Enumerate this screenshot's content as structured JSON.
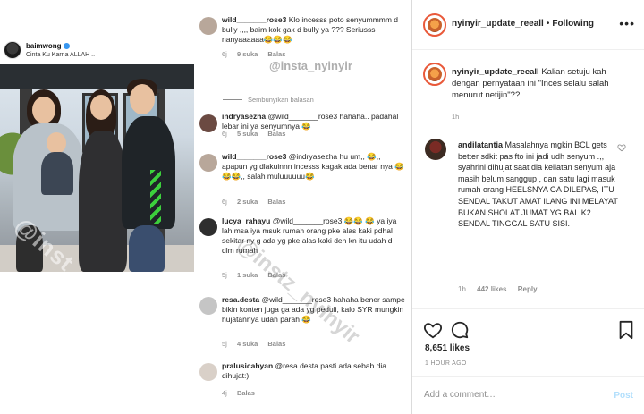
{
  "story": {
    "username": "baimwong",
    "caption": "Cinta Ku Karna ALLAH ..",
    "watermark": "@inst_nyinyir"
  },
  "comments": [
    {
      "username": "wild_______rose3",
      "text": "Klo incesss poto senyummmm d bully ,,,, baim kok gak d bully ya ??? Seriusss nanyaaaaaa😂😂😂",
      "age": "6j",
      "likes": "9 suka",
      "reply": "Balas",
      "avatar_color": "#b8a79a"
    },
    {
      "hide_replies": "Sembunyikan balasan"
    },
    {
      "username": "indryasezha",
      "text": "@wild_______rose3 hahaha.. padahal lebar ini ya senyumnya 😂",
      "age": "6j",
      "likes": "5 suka",
      "reply": "Balas",
      "avatar_color": "#6b4a42"
    },
    {
      "username": "wild_______rose3",
      "text": "@indryasezha hu um,, 😂,, apapun yg dlakuinnn incesss kagak ada benar nya 😂😂😂,, salah muluuuuuu😂",
      "age": "6j",
      "likes": "2 suka",
      "reply": "Balas",
      "avatar_color": "#b8a79a"
    },
    {
      "username": "lucya_rahayu",
      "text": "@wild_______rose3 😂😂 😂 ya iya lah msa iya msuk rumah orang pke alas kaki pdhal sekitar ny g ada yg pke alas kaki deh kn itu udah d dlm rumah",
      "age": "5j",
      "likes": "1 suka",
      "reply": "Balas",
      "avatar_color": "#2e2e2e"
    },
    {
      "username": "resa.desta",
      "text": "@wild_______rose3 hahaha bener sampe bikin konten juga ga ada yg peduli, kalo SYR mungkin hujatannya udah parah 😂",
      "age": "5j",
      "likes": "4 suka",
      "reply": "Balas",
      "avatar_color": "#c5c5c5"
    },
    {
      "username": "pralusicahyan",
      "text": "@resa.desta pasti ada sebab dia dihujat:)",
      "age": "4j",
      "reply": "Balas",
      "avatar_color": "#d9d0c8"
    }
  ],
  "comments_watermark": "@insta_nyinyir",
  "comments_watermark_big": "@instz_nyinyir",
  "post": {
    "username": "nyinyir_update_reeall",
    "follow_label": "Following",
    "more_label": "•••",
    "caption_username": "nyinyir_update_reeall",
    "caption_text": "Kalian setuju kah dengan pernyataan ini \"Inces selalu salah menurut netijin\"??",
    "caption_age": "1h",
    "comment": {
      "username": "andilatantia",
      "text": "Masalahnya mgkin BCL gets better sdkit pas fto ini jadi udh senyum .,, syahrini dihujat saat dia keliatan senyum aja masih belum sanggup , dan satu lagi masuk rumah orang HEELSNYA GA DILEPAS, ITU SENDAL TAKUT AMAT ILANG INI MELAYAT BUKAN SHOLAT JUMAT YG BALIK2 SENDAL TINGGAL SATU SISI.",
      "age": "1h",
      "likes": "442 likes",
      "reply": "Reply"
    },
    "likes": "8,651 likes",
    "time_ago": "1 HOUR AGO",
    "add_comment_placeholder": "Add a comment…",
    "post_label": "Post"
  },
  "colors": {
    "link_blue": "#3897f0",
    "muted": "#8e8e8e",
    "text": "#262626",
    "post_disabled": "#b2dffc"
  }
}
